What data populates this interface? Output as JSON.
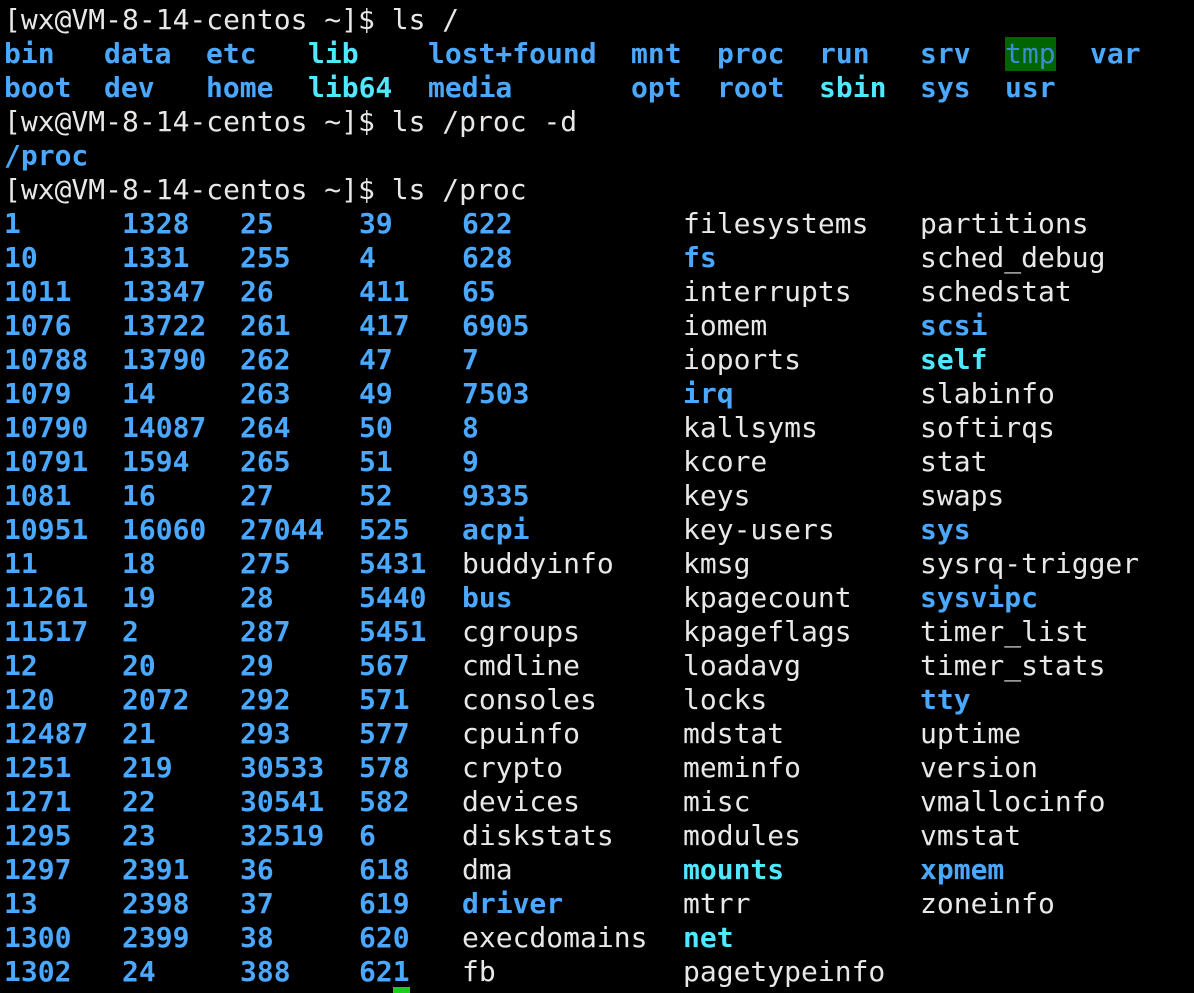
{
  "terminal": {
    "prompt": "[wx@VM-8-14-centos ~]$",
    "commands": {
      "cmd1": "ls /",
      "cmd2": "ls /proc -d",
      "cmd3": "ls /proc"
    },
    "output_ls_proc_d": "/proc",
    "root_listing": [
      [
        "bin",
        "dir"
      ],
      [
        "data",
        "dir"
      ],
      [
        "etc",
        "dir"
      ],
      [
        "lib",
        "link"
      ],
      [
        "lost+found",
        "dir"
      ],
      [
        "mnt",
        "dir"
      ],
      [
        "proc",
        "dir"
      ],
      [
        "run",
        "dir"
      ],
      [
        "srv",
        "dir"
      ],
      [
        "tmp",
        "hl"
      ],
      [
        "var",
        "dir"
      ],
      [
        "boot",
        "dir"
      ],
      [
        "dev",
        "dir"
      ],
      [
        "home",
        "dir"
      ],
      [
        "lib64",
        "link"
      ],
      [
        "media",
        "dir"
      ],
      [
        "opt",
        "dir"
      ],
      [
        "root",
        "dir"
      ],
      [
        "sbin",
        "link"
      ],
      [
        "sys",
        "dir"
      ],
      [
        "usr",
        "dir"
      ]
    ],
    "proc_columns": [
      [
        [
          "1",
          "dir"
        ],
        [
          "10",
          "dir"
        ],
        [
          "1011",
          "dir"
        ],
        [
          "1076",
          "dir"
        ],
        [
          "10788",
          "dir"
        ],
        [
          "1079",
          "dir"
        ],
        [
          "10790",
          "dir"
        ],
        [
          "10791",
          "dir"
        ],
        [
          "1081",
          "dir"
        ],
        [
          "10951",
          "dir"
        ],
        [
          "11",
          "dir"
        ],
        [
          "11261",
          "dir"
        ],
        [
          "11517",
          "dir"
        ],
        [
          "12",
          "dir"
        ],
        [
          "120",
          "dir"
        ],
        [
          "12487",
          "dir"
        ],
        [
          "1251",
          "dir"
        ],
        [
          "1271",
          "dir"
        ],
        [
          "1295",
          "dir"
        ],
        [
          "1297",
          "dir"
        ],
        [
          "13",
          "dir"
        ],
        [
          "1300",
          "dir"
        ],
        [
          "1302",
          "dir"
        ]
      ],
      [
        [
          "1328",
          "dir"
        ],
        [
          "1331",
          "dir"
        ],
        [
          "13347",
          "dir"
        ],
        [
          "13722",
          "dir"
        ],
        [
          "13790",
          "dir"
        ],
        [
          "14",
          "dir"
        ],
        [
          "14087",
          "dir"
        ],
        [
          "1594",
          "dir"
        ],
        [
          "16",
          "dir"
        ],
        [
          "16060",
          "dir"
        ],
        [
          "18",
          "dir"
        ],
        [
          "19",
          "dir"
        ],
        [
          "2",
          "dir"
        ],
        [
          "20",
          "dir"
        ],
        [
          "2072",
          "dir"
        ],
        [
          "21",
          "dir"
        ],
        [
          "219",
          "dir"
        ],
        [
          "22",
          "dir"
        ],
        [
          "23",
          "dir"
        ],
        [
          "2391",
          "dir"
        ],
        [
          "2398",
          "dir"
        ],
        [
          "2399",
          "dir"
        ],
        [
          "24",
          "dir"
        ]
      ],
      [
        [
          "25",
          "dir"
        ],
        [
          "255",
          "dir"
        ],
        [
          "26",
          "dir"
        ],
        [
          "261",
          "dir"
        ],
        [
          "262",
          "dir"
        ],
        [
          "263",
          "dir"
        ],
        [
          "264",
          "dir"
        ],
        [
          "265",
          "dir"
        ],
        [
          "27",
          "dir"
        ],
        [
          "27044",
          "dir"
        ],
        [
          "275",
          "dir"
        ],
        [
          "28",
          "dir"
        ],
        [
          "287",
          "dir"
        ],
        [
          "29",
          "dir"
        ],
        [
          "292",
          "dir"
        ],
        [
          "293",
          "dir"
        ],
        [
          "30533",
          "dir"
        ],
        [
          "30541",
          "dir"
        ],
        [
          "32519",
          "dir"
        ],
        [
          "36",
          "dir"
        ],
        [
          "37",
          "dir"
        ],
        [
          "38",
          "dir"
        ],
        [
          "388",
          "dir"
        ]
      ],
      [
        [
          "39",
          "dir"
        ],
        [
          "4",
          "dir"
        ],
        [
          "411",
          "dir"
        ],
        [
          "417",
          "dir"
        ],
        [
          "47",
          "dir"
        ],
        [
          "49",
          "dir"
        ],
        [
          "50",
          "dir"
        ],
        [
          "51",
          "dir"
        ],
        [
          "52",
          "dir"
        ],
        [
          "525",
          "dir"
        ],
        [
          "5431",
          "dir"
        ],
        [
          "5440",
          "dir"
        ],
        [
          "5451",
          "dir"
        ],
        [
          "567",
          "dir"
        ],
        [
          "571",
          "dir"
        ],
        [
          "577",
          "dir"
        ],
        [
          "578",
          "dir"
        ],
        [
          "582",
          "dir"
        ],
        [
          "6",
          "dir"
        ],
        [
          "618",
          "dir"
        ],
        [
          "619",
          "dir"
        ],
        [
          "620",
          "dir"
        ],
        [
          "621",
          "dir"
        ]
      ],
      [
        [
          "622",
          "dir"
        ],
        [
          "628",
          "dir"
        ],
        [
          "65",
          "dir"
        ],
        [
          "6905",
          "dir"
        ],
        [
          "7",
          "dir"
        ],
        [
          "7503",
          "dir"
        ],
        [
          "8",
          "dir"
        ],
        [
          "9",
          "dir"
        ],
        [
          "9335",
          "dir"
        ],
        [
          "acpi",
          "dir"
        ],
        [
          "buddyinfo",
          "plain"
        ],
        [
          "bus",
          "dir"
        ],
        [
          "cgroups",
          "plain"
        ],
        [
          "cmdline",
          "plain"
        ],
        [
          "consoles",
          "plain"
        ],
        [
          "cpuinfo",
          "plain"
        ],
        [
          "crypto",
          "plain"
        ],
        [
          "devices",
          "plain"
        ],
        [
          "diskstats",
          "plain"
        ],
        [
          "dma",
          "plain"
        ],
        [
          "driver",
          "dir"
        ],
        [
          "execdomains",
          "plain"
        ],
        [
          "fb",
          "plain"
        ]
      ],
      [
        [
          "filesystems",
          "plain"
        ],
        [
          "fs",
          "dir"
        ],
        [
          "interrupts",
          "plain"
        ],
        [
          "iomem",
          "plain"
        ],
        [
          "ioports",
          "plain"
        ],
        [
          "irq",
          "dir"
        ],
        [
          "kallsyms",
          "plain"
        ],
        [
          "kcore",
          "plain"
        ],
        [
          "keys",
          "plain"
        ],
        [
          "key-users",
          "plain"
        ],
        [
          "kmsg",
          "plain"
        ],
        [
          "kpagecount",
          "plain"
        ],
        [
          "kpageflags",
          "plain"
        ],
        [
          "loadavg",
          "plain"
        ],
        [
          "locks",
          "plain"
        ],
        [
          "mdstat",
          "plain"
        ],
        [
          "meminfo",
          "plain"
        ],
        [
          "misc",
          "plain"
        ],
        [
          "modules",
          "plain"
        ],
        [
          "mounts",
          "link"
        ],
        [
          "mtrr",
          "plain"
        ],
        [
          "net",
          "link"
        ],
        [
          "pagetypeinfo",
          "plain"
        ]
      ],
      [
        [
          "partitions",
          "plain"
        ],
        [
          "sched_debug",
          "plain"
        ],
        [
          "schedstat",
          "plain"
        ],
        [
          "scsi",
          "dir"
        ],
        [
          "self",
          "link"
        ],
        [
          "slabinfo",
          "plain"
        ],
        [
          "softirqs",
          "plain"
        ],
        [
          "stat",
          "plain"
        ],
        [
          "swaps",
          "plain"
        ],
        [
          "sys",
          "dir"
        ],
        [
          "sysrq-trigger",
          "plain"
        ],
        [
          "sysvipc",
          "dir"
        ],
        [
          "timer_list",
          "plain"
        ],
        [
          "timer_stats",
          "plain"
        ],
        [
          "tty",
          "dir"
        ],
        [
          "uptime",
          "plain"
        ],
        [
          "version",
          "plain"
        ],
        [
          "vmallocinfo",
          "plain"
        ],
        [
          "vmstat",
          "plain"
        ],
        [
          "xpmem",
          "dir"
        ],
        [
          "zoneinfo",
          "plain"
        ]
      ]
    ],
    "colors": {
      "background": "#000000",
      "plain_text": "#e8e8e8",
      "directory": "#4aa8ff",
      "symlink": "#4ee8ff",
      "sticky_highlight_bg": "#006400",
      "cursor": "#1ecb1e"
    }
  }
}
